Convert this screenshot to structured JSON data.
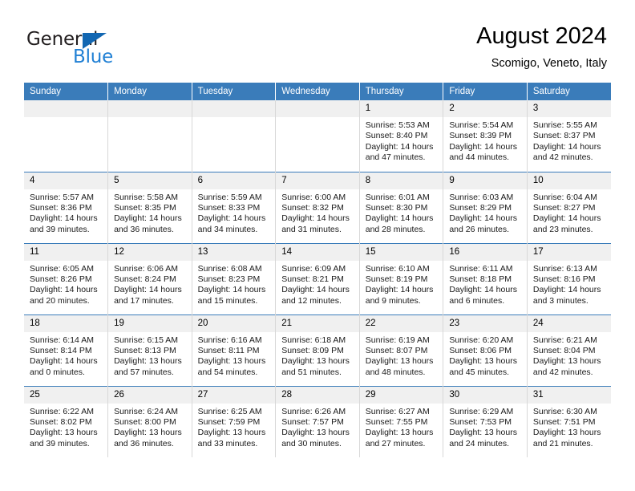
{
  "brand": {
    "name_part1": "General",
    "name_part2": "Blue",
    "accent_color": "#1f7fd4",
    "triangle_color": "#1267b2"
  },
  "header": {
    "title": "August 2024",
    "subtitle": "Scomigo, Veneto, Italy",
    "header_bg": "#3a7cba",
    "daynum_bg": "#f0f0f0"
  },
  "weekdays": [
    "Sunday",
    "Monday",
    "Tuesday",
    "Wednesday",
    "Thursday",
    "Friday",
    "Saturday"
  ],
  "labels": {
    "sunrise": "Sunrise:",
    "sunset": "Sunset:",
    "daylight": "Daylight:"
  },
  "weeks": [
    [
      {
        "day": "",
        "sunrise": "",
        "sunset": "",
        "daylight": ""
      },
      {
        "day": "",
        "sunrise": "",
        "sunset": "",
        "daylight": ""
      },
      {
        "day": "",
        "sunrise": "",
        "sunset": "",
        "daylight": ""
      },
      {
        "day": "",
        "sunrise": "",
        "sunset": "",
        "daylight": ""
      },
      {
        "day": "1",
        "sunrise": "Sunrise: 5:53 AM",
        "sunset": "Sunset: 8:40 PM",
        "daylight": "Daylight: 14 hours and 47 minutes."
      },
      {
        "day": "2",
        "sunrise": "Sunrise: 5:54 AM",
        "sunset": "Sunset: 8:39 PM",
        "daylight": "Daylight: 14 hours and 44 minutes."
      },
      {
        "day": "3",
        "sunrise": "Sunrise: 5:55 AM",
        "sunset": "Sunset: 8:37 PM",
        "daylight": "Daylight: 14 hours and 42 minutes."
      }
    ],
    [
      {
        "day": "4",
        "sunrise": "Sunrise: 5:57 AM",
        "sunset": "Sunset: 8:36 PM",
        "daylight": "Daylight: 14 hours and 39 minutes."
      },
      {
        "day": "5",
        "sunrise": "Sunrise: 5:58 AM",
        "sunset": "Sunset: 8:35 PM",
        "daylight": "Daylight: 14 hours and 36 minutes."
      },
      {
        "day": "6",
        "sunrise": "Sunrise: 5:59 AM",
        "sunset": "Sunset: 8:33 PM",
        "daylight": "Daylight: 14 hours and 34 minutes."
      },
      {
        "day": "7",
        "sunrise": "Sunrise: 6:00 AM",
        "sunset": "Sunset: 8:32 PM",
        "daylight": "Daylight: 14 hours and 31 minutes."
      },
      {
        "day": "8",
        "sunrise": "Sunrise: 6:01 AM",
        "sunset": "Sunset: 8:30 PM",
        "daylight": "Daylight: 14 hours and 28 minutes."
      },
      {
        "day": "9",
        "sunrise": "Sunrise: 6:03 AM",
        "sunset": "Sunset: 8:29 PM",
        "daylight": "Daylight: 14 hours and 26 minutes."
      },
      {
        "day": "10",
        "sunrise": "Sunrise: 6:04 AM",
        "sunset": "Sunset: 8:27 PM",
        "daylight": "Daylight: 14 hours and 23 minutes."
      }
    ],
    [
      {
        "day": "11",
        "sunrise": "Sunrise: 6:05 AM",
        "sunset": "Sunset: 8:26 PM",
        "daylight": "Daylight: 14 hours and 20 minutes."
      },
      {
        "day": "12",
        "sunrise": "Sunrise: 6:06 AM",
        "sunset": "Sunset: 8:24 PM",
        "daylight": "Daylight: 14 hours and 17 minutes."
      },
      {
        "day": "13",
        "sunrise": "Sunrise: 6:08 AM",
        "sunset": "Sunset: 8:23 PM",
        "daylight": "Daylight: 14 hours and 15 minutes."
      },
      {
        "day": "14",
        "sunrise": "Sunrise: 6:09 AM",
        "sunset": "Sunset: 8:21 PM",
        "daylight": "Daylight: 14 hours and 12 minutes."
      },
      {
        "day": "15",
        "sunrise": "Sunrise: 6:10 AM",
        "sunset": "Sunset: 8:19 PM",
        "daylight": "Daylight: 14 hours and 9 minutes."
      },
      {
        "day": "16",
        "sunrise": "Sunrise: 6:11 AM",
        "sunset": "Sunset: 8:18 PM",
        "daylight": "Daylight: 14 hours and 6 minutes."
      },
      {
        "day": "17",
        "sunrise": "Sunrise: 6:13 AM",
        "sunset": "Sunset: 8:16 PM",
        "daylight": "Daylight: 14 hours and 3 minutes."
      }
    ],
    [
      {
        "day": "18",
        "sunrise": "Sunrise: 6:14 AM",
        "sunset": "Sunset: 8:14 PM",
        "daylight": "Daylight: 14 hours and 0 minutes."
      },
      {
        "day": "19",
        "sunrise": "Sunrise: 6:15 AM",
        "sunset": "Sunset: 8:13 PM",
        "daylight": "Daylight: 13 hours and 57 minutes."
      },
      {
        "day": "20",
        "sunrise": "Sunrise: 6:16 AM",
        "sunset": "Sunset: 8:11 PM",
        "daylight": "Daylight: 13 hours and 54 minutes."
      },
      {
        "day": "21",
        "sunrise": "Sunrise: 6:18 AM",
        "sunset": "Sunset: 8:09 PM",
        "daylight": "Daylight: 13 hours and 51 minutes."
      },
      {
        "day": "22",
        "sunrise": "Sunrise: 6:19 AM",
        "sunset": "Sunset: 8:07 PM",
        "daylight": "Daylight: 13 hours and 48 minutes."
      },
      {
        "day": "23",
        "sunrise": "Sunrise: 6:20 AM",
        "sunset": "Sunset: 8:06 PM",
        "daylight": "Daylight: 13 hours and 45 minutes."
      },
      {
        "day": "24",
        "sunrise": "Sunrise: 6:21 AM",
        "sunset": "Sunset: 8:04 PM",
        "daylight": "Daylight: 13 hours and 42 minutes."
      }
    ],
    [
      {
        "day": "25",
        "sunrise": "Sunrise: 6:22 AM",
        "sunset": "Sunset: 8:02 PM",
        "daylight": "Daylight: 13 hours and 39 minutes."
      },
      {
        "day": "26",
        "sunrise": "Sunrise: 6:24 AM",
        "sunset": "Sunset: 8:00 PM",
        "daylight": "Daylight: 13 hours and 36 minutes."
      },
      {
        "day": "27",
        "sunrise": "Sunrise: 6:25 AM",
        "sunset": "Sunset: 7:59 PM",
        "daylight": "Daylight: 13 hours and 33 minutes."
      },
      {
        "day": "28",
        "sunrise": "Sunrise: 6:26 AM",
        "sunset": "Sunset: 7:57 PM",
        "daylight": "Daylight: 13 hours and 30 minutes."
      },
      {
        "day": "29",
        "sunrise": "Sunrise: 6:27 AM",
        "sunset": "Sunset: 7:55 PM",
        "daylight": "Daylight: 13 hours and 27 minutes."
      },
      {
        "day": "30",
        "sunrise": "Sunrise: 6:29 AM",
        "sunset": "Sunset: 7:53 PM",
        "daylight": "Daylight: 13 hours and 24 minutes."
      },
      {
        "day": "31",
        "sunrise": "Sunrise: 6:30 AM",
        "sunset": "Sunset: 7:51 PM",
        "daylight": "Daylight: 13 hours and 21 minutes."
      }
    ]
  ]
}
